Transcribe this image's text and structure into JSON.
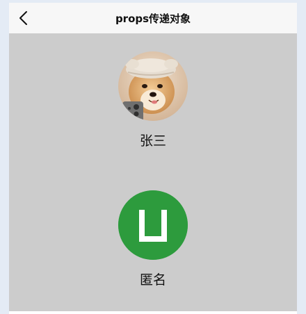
{
  "navbar": {
    "title": "props传递对象",
    "back_icon": "chevron-left-icon"
  },
  "profiles": [
    {
      "name": "张三",
      "avatar": "shiba-dog-photo"
    },
    {
      "name": "匿名",
      "avatar": "anonymous-default-avatar",
      "avatar_color": "#2d9b3d"
    }
  ],
  "colors": {
    "page_background": "#e4ebf5",
    "content_background": "#cccccc",
    "navbar_background": "#f7f7f7",
    "default_avatar_green": "#2d9b3d"
  }
}
